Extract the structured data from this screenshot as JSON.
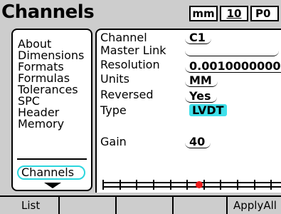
{
  "header": {
    "title": "Channels",
    "unit": "mm",
    "indicator_gear": "10",
    "indicator_part": "P0"
  },
  "menu": {
    "items": [
      "About",
      "Dimensions",
      "Formats",
      "Formulas",
      "Tolerances",
      "SPC",
      "Header",
      "Memory"
    ],
    "selected": "Channels",
    "selected_color": "#2bd6de"
  },
  "fields": {
    "channel": {
      "label": "Channel",
      "value": "C1"
    },
    "master_link": {
      "label": "Master Link",
      "value": ""
    },
    "resolution": {
      "label": "Resolution",
      "value": "0.0010000000"
    },
    "units": {
      "label": "Units",
      "value": "MM"
    },
    "reversed": {
      "label": "Reversed",
      "value": "Yes"
    },
    "type": {
      "label": "Type",
      "value": "LVDT",
      "highlight_color": "#3fe0ea"
    },
    "gain": {
      "label": "Gain",
      "value": "40"
    }
  },
  "bargraph": {
    "marker_position": 0.52,
    "marker_color": "#ee1b1b"
  },
  "softkeys": [
    "List",
    "",
    "",
    "",
    "ApplyAll"
  ],
  "icons": [
    "down-arrow-icon"
  ]
}
